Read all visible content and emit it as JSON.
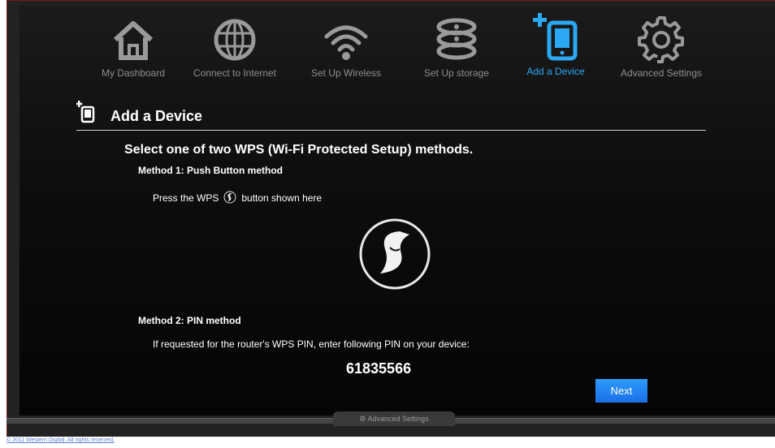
{
  "nav": {
    "items": [
      {
        "label": "My Dashboard",
        "icon": "home-icon",
        "active": false
      },
      {
        "label": "Connect to Internet",
        "icon": "globe-icon",
        "active": false
      },
      {
        "label": "Set Up Wireless",
        "icon": "wifi-icon",
        "active": false
      },
      {
        "label": "Set Up storage",
        "icon": "storage-icon",
        "active": false
      },
      {
        "label": "Add a Device",
        "icon": "add-device-icon",
        "active": true
      },
      {
        "label": "Advanced Settings",
        "icon": "gear-icon",
        "active": false
      }
    ]
  },
  "page": {
    "title": "Add a Device",
    "heading": "Select one of two WPS (Wi-Fi Protected Setup) methods.",
    "method1": {
      "title": "Method 1: Push Button method",
      "text_before": "Press the WPS",
      "text_after": "button shown here"
    },
    "method2": {
      "title": "Method 2: PIN method",
      "text": "If requested for the router's WPS PIN, enter following PIN on your device:",
      "pin": "61835566"
    },
    "next_label": "Next"
  },
  "bottom_tab": {
    "label": "Advanced Settings"
  },
  "footer": {
    "copyright": "© 2011 Western Digital. All rights reserved."
  },
  "colors": {
    "accent": "#2aa8f4",
    "button": "#1a6fe6",
    "inactive": "#8e8e8e"
  }
}
